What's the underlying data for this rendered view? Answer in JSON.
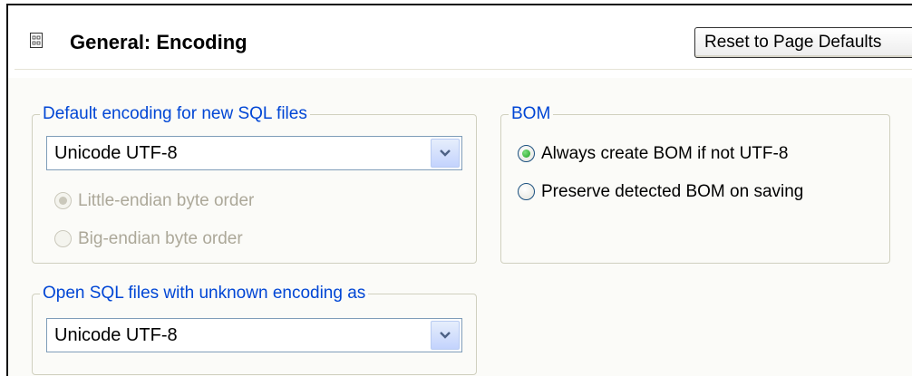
{
  "header": {
    "title": "General: Encoding",
    "reset_label": "Reset to Page Defaults"
  },
  "default_encoding": {
    "group_label": "Default encoding for new SQL files",
    "selected": "Unicode UTF-8",
    "byte_order": {
      "little_endian_label": "Little-endian byte order",
      "big_endian_label": "Big-endian byte order",
      "selected": "little-endian",
      "enabled": false
    }
  },
  "bom": {
    "group_label": "BOM",
    "options": [
      {
        "label": "Always create BOM if not UTF-8",
        "checked": true
      },
      {
        "label": "Preserve detected BOM on saving",
        "checked": false
      }
    ]
  },
  "unknown_encoding": {
    "group_label": "Open SQL files with unknown encoding as",
    "selected": "Unicode UTF-8"
  },
  "colors": {
    "group_label": "#0046d5",
    "disabled_text": "#aca899",
    "radio_checked_dot": "#21a121"
  }
}
